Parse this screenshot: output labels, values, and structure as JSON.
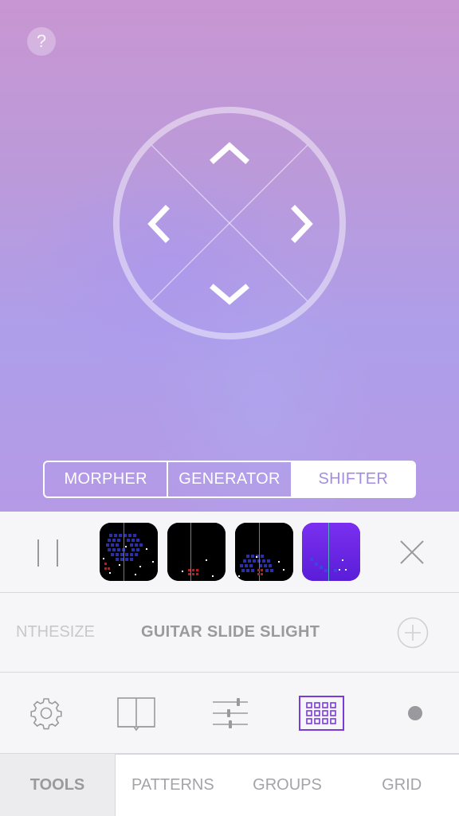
{
  "stage": {
    "help_label": "?",
    "dpad_icons": [
      "chevron-up-icon",
      "chevron-left-icon",
      "chevron-right-icon",
      "chevron-down-icon"
    ]
  },
  "modes": {
    "items": [
      {
        "label": "MORPHER",
        "active": false
      },
      {
        "label": "GENERATOR",
        "active": false
      },
      {
        "label": "SHIFTER",
        "active": true
      }
    ]
  },
  "player": {
    "pause_icon": "pause-icon",
    "close_icon": "close-icon",
    "thumbnails": [
      "pattern-thumbnail",
      "pattern-thumbnail",
      "pattern-thumbnail",
      "pattern-thumbnail"
    ]
  },
  "preset": {
    "previous": "NTHESIZE",
    "current": "GUITAR SLIDE SLIGHT",
    "add_icon": "add-circle-icon"
  },
  "toolbar": {
    "icons": [
      "gear-icon",
      "book-icon",
      "sliders-icon",
      "grid-icon",
      "record-dot-icon"
    ],
    "selected": "grid-icon"
  },
  "tabs": {
    "tools": "TOOLS",
    "items": [
      "PATTERNS",
      "GROUPS",
      "GRID"
    ]
  },
  "colors": {
    "accent": "#7a3cd9",
    "segment_text_active": "#a58ee0"
  }
}
